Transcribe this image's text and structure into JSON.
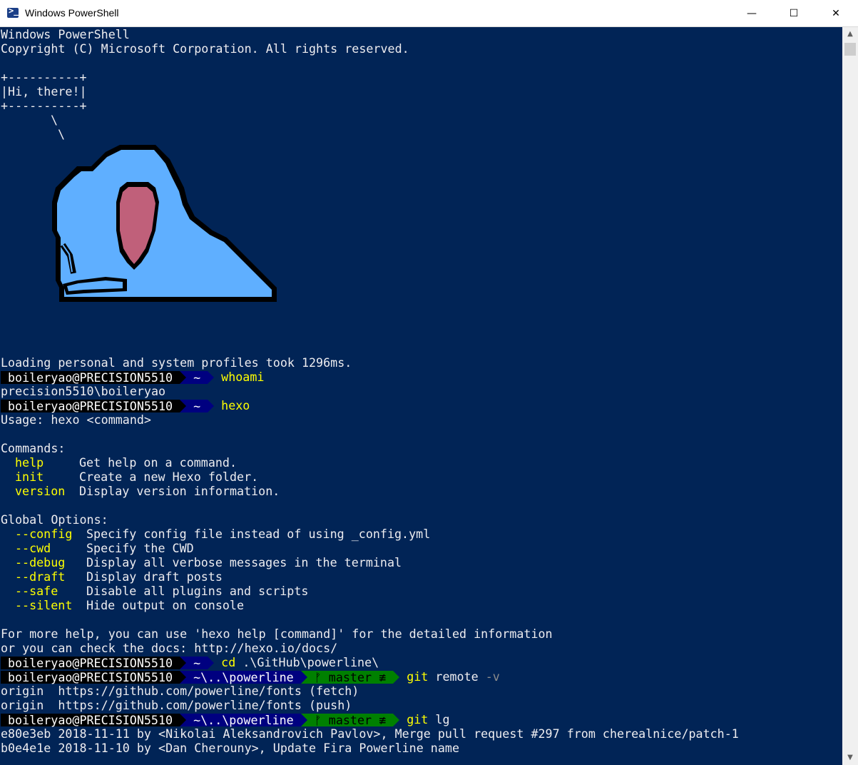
{
  "window": {
    "title": "Windows PowerShell",
    "icon": "powershell-icon",
    "minimize": "—",
    "maximize": "☐",
    "close": "✕"
  },
  "terminal": {
    "banner_title": "Windows PowerShell",
    "banner_copyright": "Copyright (C) Microsoft Corporation. All rights reserved.",
    "box_top": "+----------+",
    "box_text": "|Hi, there!|",
    "box_bottom": "+----------+",
    "bubble_tail_1": "\\",
    "bubble_tail_2": "\\",
    "profile_load": "Loading personal and system profiles took 1296ms.",
    "user": "boileryao@PRECISION5510",
    "home": "~",
    "path_powerline": "~\\..\\powerline",
    "git_branch": "ᚠ master ≢",
    "cmd_whoami": "whoami",
    "out_whoami": "precision5510\\boileryao",
    "cmd_hexo": "hexo",
    "hexo_usage": "Usage: hexo <command>",
    "commands_header": "Commands:",
    "commands": [
      {
        "name": "help",
        "desc": "Get help on a command."
      },
      {
        "name": "init",
        "desc": "Create a new Hexo folder."
      },
      {
        "name": "version",
        "desc": "Display version information."
      }
    ],
    "options_header": "Global Options:",
    "options": [
      {
        "name": "--config",
        "desc": "Specify config file instead of using _config.yml"
      },
      {
        "name": "--cwd",
        "desc": "Specify the CWD"
      },
      {
        "name": "--debug",
        "desc": "Display all verbose messages in the terminal"
      },
      {
        "name": "--draft",
        "desc": "Display draft posts"
      },
      {
        "name": "--safe",
        "desc": "Disable all plugins and scripts"
      },
      {
        "name": "--silent",
        "desc": "Hide output on console"
      }
    ],
    "help_line_1": "For more help, you can use 'hexo help [command]' for the detailed information",
    "help_line_2": "or you can check the docs: http://hexo.io/docs/",
    "cmd_cd": "cd",
    "cmd_cd_arg": ".\\GitHub\\powerline\\",
    "cmd_git_remote": "git",
    "cmd_git_remote_arg": "remote",
    "cmd_git_remote_flag": "-v",
    "remote_fetch": "origin  https://github.com/powerline/fonts (fetch)",
    "remote_push": "origin  https://github.com/powerline/fonts (push)",
    "cmd_git_lg": "git",
    "cmd_git_lg_arg": "lg",
    "log_1": "e80e3eb 2018-11-11 by <Nikolai Aleksandrovich Pavlov>, Merge pull request #297 from cherealnice/patch-1",
    "log_2": "b0e4e1e 2018-11-10 by <Dan Cherouny>, Update Fira Powerline name"
  },
  "colors": {
    "background": "#012456",
    "text": "#eeedf0",
    "command": "#ffff00",
    "bird_body": "#5fafff",
    "bird_beak": "#c0607a"
  }
}
